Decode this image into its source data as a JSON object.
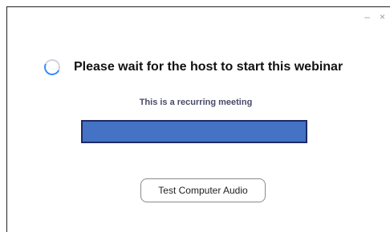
{
  "window": {
    "minimize_glyph": "–",
    "close_glyph": "×"
  },
  "waiting": {
    "title": "Please wait for the host to start this webinar",
    "subtitle": "This is a recurring meeting",
    "spinner_icon": "loading-spinner-icon"
  },
  "progress": {
    "fraction": 1.0,
    "fill_color": "#4472c4"
  },
  "buttons": {
    "test_audio_label": "Test Computer Audio"
  }
}
